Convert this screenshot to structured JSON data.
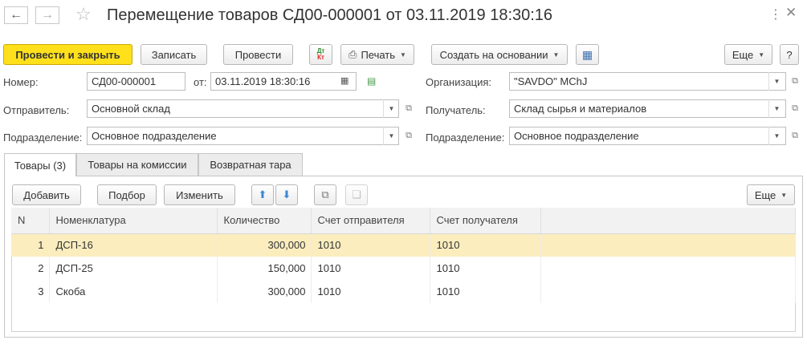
{
  "window": {
    "title": "Перемещение товаров СД00-000001 от 03.11.2019 18:30:16"
  },
  "toolbar": {
    "post_close": "Провести и закрыть",
    "save": "Записать",
    "post": "Провести",
    "dtkt_top": "Дт",
    "dtkt_bottom": "Кт",
    "print": "Печать",
    "create_based": "Создать на основании",
    "more": "Еще",
    "help": "?"
  },
  "form": {
    "number_label": "Номер:",
    "number_value": "СД00-000001",
    "date_label": "от:",
    "date_value": "03.11.2019 18:30:16",
    "org_label": "Организация:",
    "org_value": "\"SAVDO\" MChJ",
    "sender_label": "Отправитель:",
    "sender_value": "Основной склад",
    "receiver_label": "Получатель:",
    "receiver_value": "Склад сырья и материалов",
    "dept_label_left": "Подразделение:",
    "dept_value_left": "Основное подразделение",
    "dept_label_right": "Подразделение:",
    "dept_value_right": "Основное подразделение"
  },
  "tabs": [
    {
      "label": "Товары (3)"
    },
    {
      "label": "Товары на комиссии"
    },
    {
      "label": "Возвратная тара"
    }
  ],
  "table_toolbar": {
    "add": "Добавить",
    "pick": "Подбор",
    "change": "Изменить",
    "more": "Еще"
  },
  "table": {
    "columns": [
      "N",
      "Номенклатура",
      "Количество",
      "Счет отправителя",
      "Счет получателя"
    ],
    "rows": [
      {
        "n": "1",
        "item": "ДСП-16",
        "qty": "300,000",
        "acc_from": "1010",
        "acc_to": "1010"
      },
      {
        "n": "2",
        "item": "ДСП-25",
        "qty": "150,000",
        "acc_from": "1010",
        "acc_to": "1010"
      },
      {
        "n": "3",
        "item": "Скоба",
        "qty": "300,000",
        "acc_from": "1010",
        "acc_to": "1010"
      }
    ]
  },
  "colors": {
    "primary_button": "#ffe01b",
    "selected_row": "#fbedbe",
    "arrow_blue": "#3b88d6"
  }
}
